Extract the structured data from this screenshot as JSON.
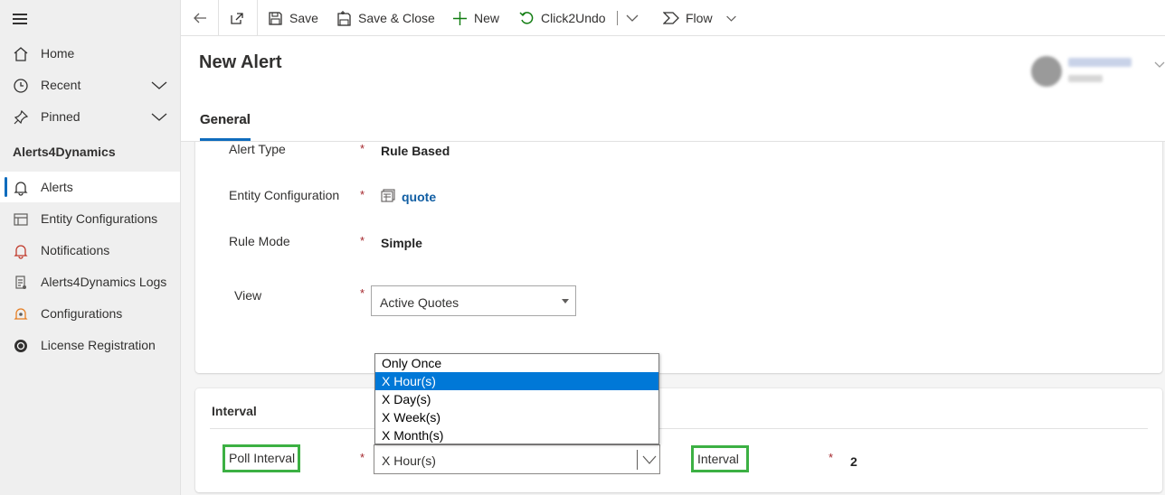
{
  "sidebar": {
    "items": [
      {
        "label": "Home",
        "icon": "home-icon"
      },
      {
        "label": "Recent",
        "icon": "clock-icon"
      },
      {
        "label": "Pinned",
        "icon": "pin-icon"
      }
    ],
    "app_title": "Alerts4Dynamics",
    "app_items": [
      {
        "label": "Alerts",
        "icon": "bell-icon",
        "active": true
      },
      {
        "label": "Entity Configurations",
        "icon": "entity-icon"
      },
      {
        "label": "Notifications",
        "icon": "bell-icon"
      },
      {
        "label": "Alerts4Dynamics Logs",
        "icon": "log-icon"
      },
      {
        "label": "Configurations",
        "icon": "config-icon"
      },
      {
        "label": "License Registration",
        "icon": "license-icon"
      }
    ]
  },
  "toolbar": {
    "save": "Save",
    "save_close": "Save & Close",
    "new": "New",
    "click2undo": "Click2Undo",
    "flow": "Flow"
  },
  "header": {
    "title": "New Alert",
    "tabs": [
      {
        "label": "General",
        "active": true
      }
    ]
  },
  "form": {
    "alert_type": {
      "label": "Alert Type",
      "value": "Rule Based"
    },
    "entity_configuration": {
      "label": "Entity Configuration",
      "value": "quote"
    },
    "rule_mode": {
      "label": "Rule Mode",
      "value": "Simple"
    },
    "view": {
      "label": "View",
      "value": "Active Quotes"
    },
    "required_marker": "*"
  },
  "interval_section": {
    "title": "Interval",
    "poll_interval": {
      "label": "Poll Interval",
      "value": "X Hour(s)",
      "options": [
        "Only Once",
        "X Hour(s)",
        "X Day(s)",
        "X Week(s)",
        "X Month(s)"
      ],
      "selected_index": 1
    },
    "interval": {
      "label": "Interval",
      "value": "2"
    }
  },
  "colors": {
    "accent": "#0f6cbd",
    "required": "#a4262c",
    "highlight": "#3cb043",
    "selected_option": "#0078d7"
  }
}
